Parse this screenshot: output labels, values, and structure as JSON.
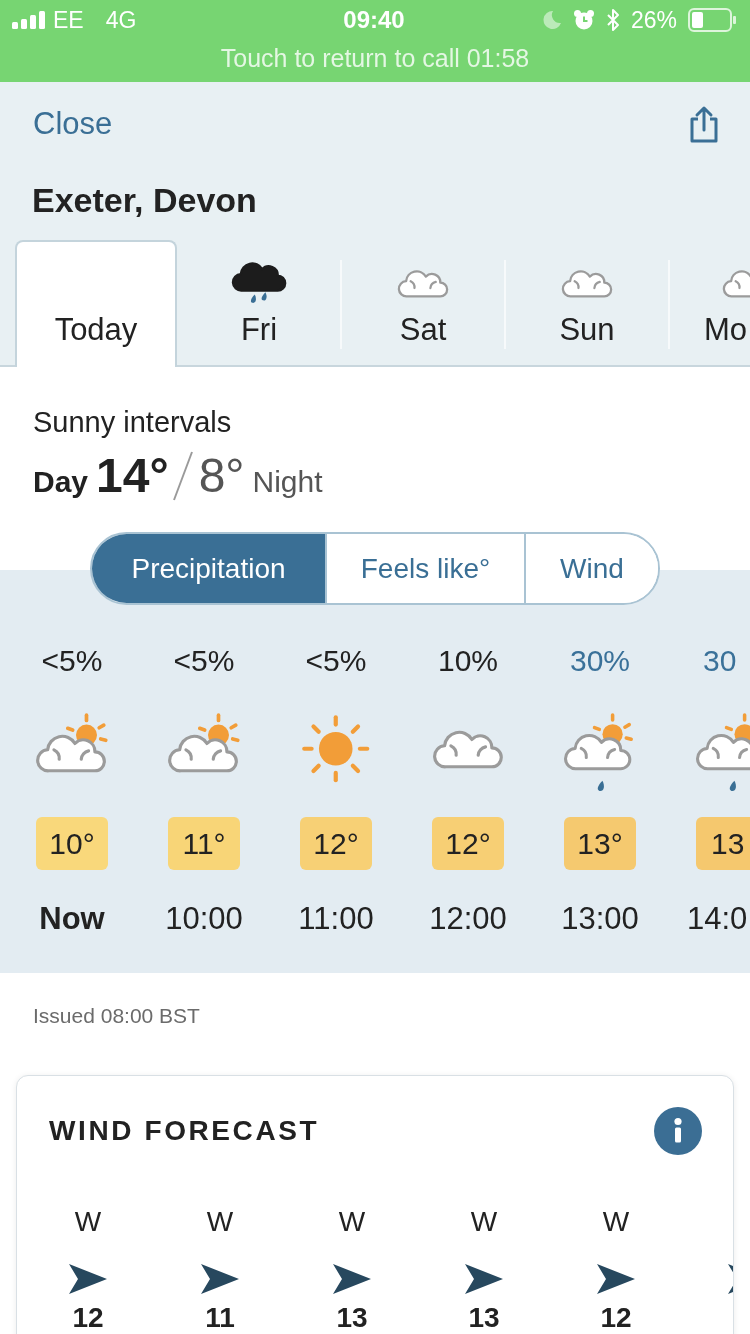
{
  "status_bar": {
    "carrier": "EE",
    "network": "4G",
    "time": "09:40",
    "battery": "26%",
    "call_banner": "Touch to return to call 01:58"
  },
  "header": {
    "close": "Close",
    "location": "Exeter, Devon"
  },
  "day_tabs": [
    {
      "label": "Today",
      "kind": "none",
      "selected": true
    },
    {
      "label": "Fri",
      "kind": "rain",
      "selected": false
    },
    {
      "label": "Sat",
      "kind": "cloudy",
      "selected": false
    },
    {
      "label": "Sun",
      "kind": "cloudy",
      "selected": false
    },
    {
      "label": "Mo",
      "kind": "cloudy",
      "selected": false
    }
  ],
  "summary": {
    "condition": "Sunny intervals",
    "day_label": "Day",
    "day_temp": "14°",
    "night_temp": "8°",
    "night_label": "Night"
  },
  "view_toggle": [
    {
      "label": "Precipitation",
      "selected": true
    },
    {
      "label": "Feels like°",
      "selected": false
    },
    {
      "label": "Wind",
      "selected": false
    }
  ],
  "hourly": [
    {
      "precip": {
        "text": "<5%",
        "color": "#222222"
      },
      "kind": "partly-cloudy",
      "temp": {
        "text": "10°",
        "color": "#f9d87b"
      },
      "time": "Now",
      "current": true
    },
    {
      "precip": {
        "text": "<5%",
        "color": "#222222"
      },
      "kind": "partly-cloudy",
      "temp": {
        "text": "11°",
        "color": "#f8d577"
      },
      "time": "10:00",
      "current": false
    },
    {
      "precip": {
        "text": "<5%",
        "color": "#222222"
      },
      "kind": "sunny",
      "temp": {
        "text": "12°",
        "color": "#f7d075"
      },
      "time": "11:00",
      "current": false
    },
    {
      "precip": {
        "text": "10%",
        "color": "#222222"
      },
      "kind": "cloudy",
      "temp": {
        "text": "12°",
        "color": "#f7cf74"
      },
      "time": "12:00",
      "current": false
    },
    {
      "precip": {
        "text": "30%",
        "color": "#3a7199"
      },
      "kind": "light-rain",
      "temp": {
        "text": "13°",
        "color": "#f5c96f"
      },
      "time": "13:00",
      "current": false
    },
    {
      "precip": {
        "text": "30",
        "color": "#3a7199"
      },
      "kind": "light-rain",
      "temp": {
        "text": "13",
        "color": "#f5c86e"
      },
      "time": "14:0",
      "current": false
    }
  ],
  "issued": "Issued 08:00 BST",
  "wind_forecast": {
    "title": "WIND FORECAST",
    "items": [
      {
        "direction": "W",
        "speed": "12"
      },
      {
        "direction": "W",
        "speed": "11"
      },
      {
        "direction": "W",
        "speed": "13"
      },
      {
        "direction": "W",
        "speed": "13"
      },
      {
        "direction": "W",
        "speed": "12"
      }
    ]
  }
}
